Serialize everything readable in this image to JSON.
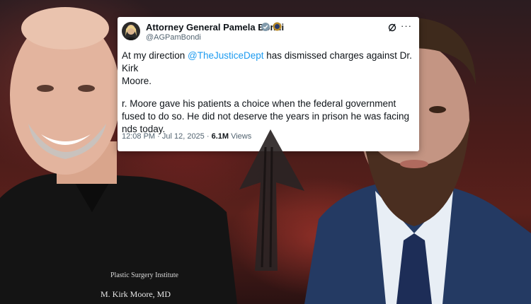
{
  "tweet": {
    "author_name": "Attorney General Pamela Bondi",
    "author_handle": "@AGPamBondi",
    "line1_prefix": "At my direction ",
    "mention": "@TheJusticeDept",
    "line1_suffix": " has dismissed charges against Dr. Kirk",
    "line2": "Moore.",
    "para2_line1": "r. Moore gave his patients a choice when the federal government",
    "para2_line2": "fused to do so. He did not deserve the years in prison he was facing",
    "para2_line3": "nds today.",
    "time_date": "12:08 PM · Jul 12, 2025 · ",
    "views_count": "6.1M",
    "views_label": " Views"
  },
  "scrub_text": {
    "text": "M. Kirk Moore, MD",
    "logo": "Plastic Surgery Institute"
  },
  "colors": {
    "mention": "#1d9bf0",
    "verified": "#1d9bf0"
  }
}
